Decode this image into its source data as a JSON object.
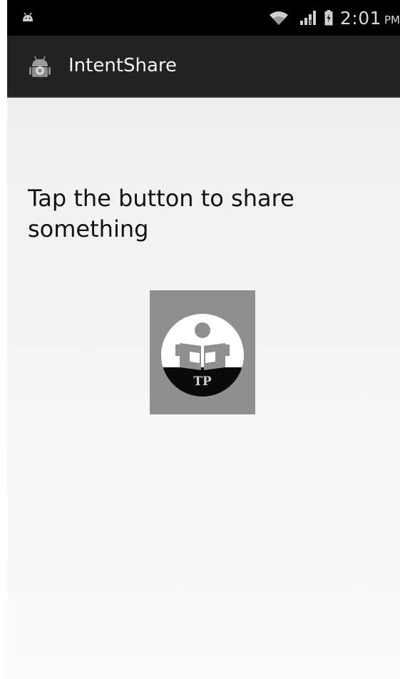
{
  "status_bar": {
    "time": "2:01",
    "ampm": "PM",
    "icons": [
      "android-notification-icon",
      "wifi-icon",
      "signal-icon",
      "battery-icon"
    ]
  },
  "action_bar": {
    "title": "IntentShare",
    "icon": "android-app-icon"
  },
  "main": {
    "prompt": "Tap the button to share something",
    "share_button": {
      "icon": "tp-logo-icon",
      "logo_text": "TP"
    }
  },
  "colors": {
    "status_bar_bg": "#000000",
    "action_bar_bg": "#222222",
    "button_bg": "#8f8f8f"
  }
}
